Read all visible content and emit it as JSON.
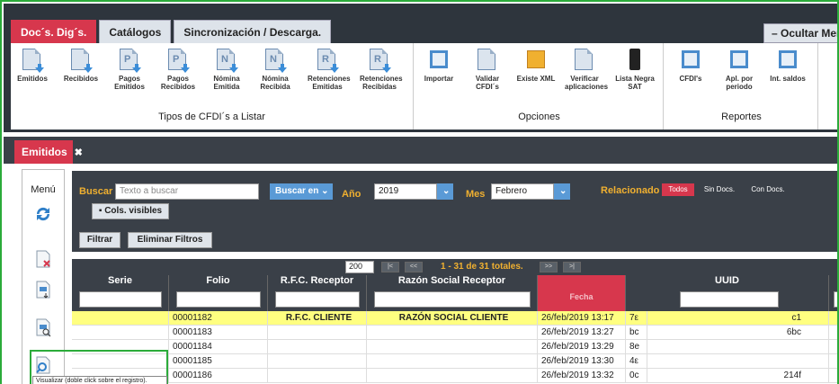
{
  "top_tabs": [
    {
      "label": "Doc´s. Dig´s.",
      "active": true
    },
    {
      "label": "Catálogos",
      "active": false
    },
    {
      "label": "Sincronización / Descarga.",
      "active": false
    }
  ],
  "hide_menu_label": "– Ocultar Menú",
  "ribbon": {
    "groups": [
      {
        "label": "Tipos de CFDI´s a Listar",
        "items": [
          "Emitidos",
          "Recibidos",
          "Pagos Emitidos",
          "Pagos Recibidos",
          "Nómina Emitida",
          "Nómina Recibida",
          "Retenciones Emitidas",
          "Retenciones Recibidas"
        ]
      },
      {
        "label": "Opciones",
        "items": [
          "Importar",
          "Validar CFDI´s",
          "Existe XML",
          "Verificar aplicaciones",
          "Lista Negra SAT"
        ]
      },
      {
        "label": "Reportes",
        "items": [
          "CFDI's",
          "Apl. por periodo",
          "Int. saldos"
        ]
      }
    ]
  },
  "panel_tab": {
    "label": "Emitidos",
    "close": "✖"
  },
  "side_menu": {
    "title": "Menú"
  },
  "filter": {
    "search_label": "Buscar",
    "search_placeholder": "Texto a buscar",
    "search_in": "Buscar en",
    "year_label": "Año",
    "year_value": "2019",
    "month_label": "Mes",
    "month_value": "Febrero",
    "related_label": "Relacionado",
    "related_options": [
      "Todos",
      "Sin Docs.",
      "Con Docs."
    ],
    "cols_visible": "Cols. visibles",
    "filter_btn": "Filtrar",
    "clear_btn": "Eliminar Filtros"
  },
  "pager": {
    "page_size": "200",
    "summary": "1 - 31 de 31 totales."
  },
  "grid": {
    "columns": [
      "Serie",
      "Folio",
      "R.F.C. Receptor",
      "Razón Social Receptor",
      "Fecha",
      "UUID",
      ""
    ],
    "rows": [
      [
        "",
        "00001182",
        "R.F.C. CLIENTE",
        "RAZÓN SOCIAL CLIENTE",
        "26/feb/2019 13:17",
        "7ε",
        "c1"
      ],
      [
        "",
        "00001183",
        "",
        "",
        "26/feb/2019 13:27",
        "bc",
        "6bc"
      ],
      [
        "",
        "00001184",
        "",
        "",
        "26/feb/2019 13:29",
        "8e",
        ""
      ],
      [
        "",
        "00001185",
        "",
        "",
        "26/feb/2019 13:30",
        "4ε",
        ""
      ],
      [
        "",
        "00001186",
        "",
        "",
        "26/feb/2019 13:32",
        "0c",
        "214f"
      ]
    ]
  },
  "tooltip": "Visualizar (doble click sobre el registro)."
}
